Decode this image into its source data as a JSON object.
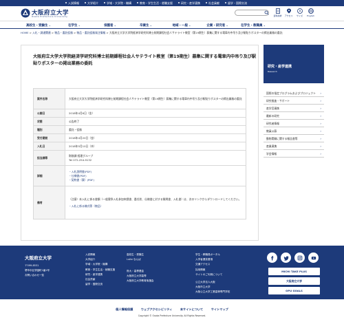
{
  "util_bar": {
    "items": [
      "入試情報",
      "大学紹介",
      "学域・大学院・機構",
      "教育・学生生活・就職支援",
      "研究・産学連携",
      "社会貢献",
      "留学・国際交流"
    ]
  },
  "header": {
    "logo_jp": "大阪府立大学",
    "logo_en": "Osaka Prefecture University",
    "icons": [
      {
        "name": "access-map-icon",
        "label": "資料請求"
      },
      {
        "name": "access-pin-icon",
        "label": "アクセス"
      },
      {
        "name": "font-size-icon",
        "label": "サイズ"
      },
      {
        "name": "globe-icon",
        "label": "English"
      }
    ]
  },
  "gnav": {
    "items": [
      "高校生・受験生",
      "在学生",
      "保護者",
      "卒業生",
      "地域・一般",
      "企業・研究者",
      "在学生・教職員"
    ]
  },
  "breadcrumb": {
    "parts": [
      "HOME",
      "入札・調達関連",
      "物品・委託役務",
      "物品・委託役務発注情報",
      "大阪府立大学大学院経済学研究科博士前期課程社会人サテライト教室（第19期生）募集に関する電車内中吊り及び駅貼りポスターの掲出業務の委託"
    ]
  },
  "page": {
    "title": "大阪府立大学大学院経済学研究科博士前期課程社会人サテライト教室（第19期生）募集に関する電車内中吊り及び駅貼りポスターの掲出業務の委託"
  },
  "table": {
    "rows": [
      {
        "key": "案件名称",
        "value": "大阪府立大学大学院経済学研究科博士前期課程社会人サテライト教室（第19期生）募集に関する電車内中吊り及び駅貼りポスターの掲出業務の委託"
      },
      {
        "key": "公開日",
        "value": "2018年4月6日（金）"
      },
      {
        "key": "状態",
        "value": "公告終了"
      },
      {
        "key": "種別",
        "value": "委託・役務"
      },
      {
        "key": "受付期間",
        "value": "2018年4月20日（金）"
      },
      {
        "key": "入札日",
        "value": "2018年5月10日（木）"
      },
      {
        "key": "担当課等",
        "value": "財務課 経理グループ",
        "value2": "Tel 072-254-9132"
      },
      {
        "key": "詳細",
        "links": [
          "入札説明書(PDF)",
          "仕様書(PDF)",
          "契約書（案）(PDF)"
        ]
      },
      {
        "key": "備考",
        "value": "（注意）本入札に係る書類（一般競争入札参加申請書、委任状、仕様書に対する質問書、入札書）は、次のリンクからダウンロードしてください。",
        "link": "入札に係る様式等（物品）"
      }
    ]
  },
  "sidebar": {
    "head_title": "研究・産学連携",
    "head_sub": "Research",
    "items": [
      "国際の指定プログラムおよびプロジェクト",
      "研究推進・サポート",
      "産学官連携",
      "最新の研究",
      "研究者情報",
      "教員公募",
      "動物実験に関する報告書等",
      "産業連携",
      "学会情報"
    ]
  },
  "footer": {
    "university": "大阪府立大学",
    "address_lines": [
      "〒599-8531",
      "堺市中区学園町1番1号",
      "お問い合わせ一覧"
    ],
    "col1": [
      "入試情報",
      "大学紹介",
      "学域・大学院・機構",
      "教育・学生生活・就職支援",
      "研究・産学連携",
      "社会貢献",
      "留学・国際交流"
    ],
    "col2": [
      "高校生・受験生",
      "i-site なんば"
    ],
    "col3": [
      "府大・高専基金",
      "大阪府立大学高専",
      "大阪府立大学教育後援会"
    ],
    "col4": [
      "学生・教職員ポータル",
      "入学者選抜要項",
      "交通アクセス",
      "採用情報",
      "サイトのご利用について",
      "公立大学法人大阪",
      "大阪市立大学",
      "大阪公立大学工業高等専門学校"
    ],
    "banners": [
      "MICHI TAKE PLUS",
      "大阪府立大学",
      "OPU GOALS"
    ],
    "bottom_links": [
      "個人情報保護",
      "ウェブアクセシビリティ",
      "本サイトについて",
      "サイトマップ"
    ],
    "copyright": "Copyright © Osaka Prefecture University. All Rights Reserved."
  },
  "colors": {
    "brand_navy": "#1d3a7a"
  }
}
